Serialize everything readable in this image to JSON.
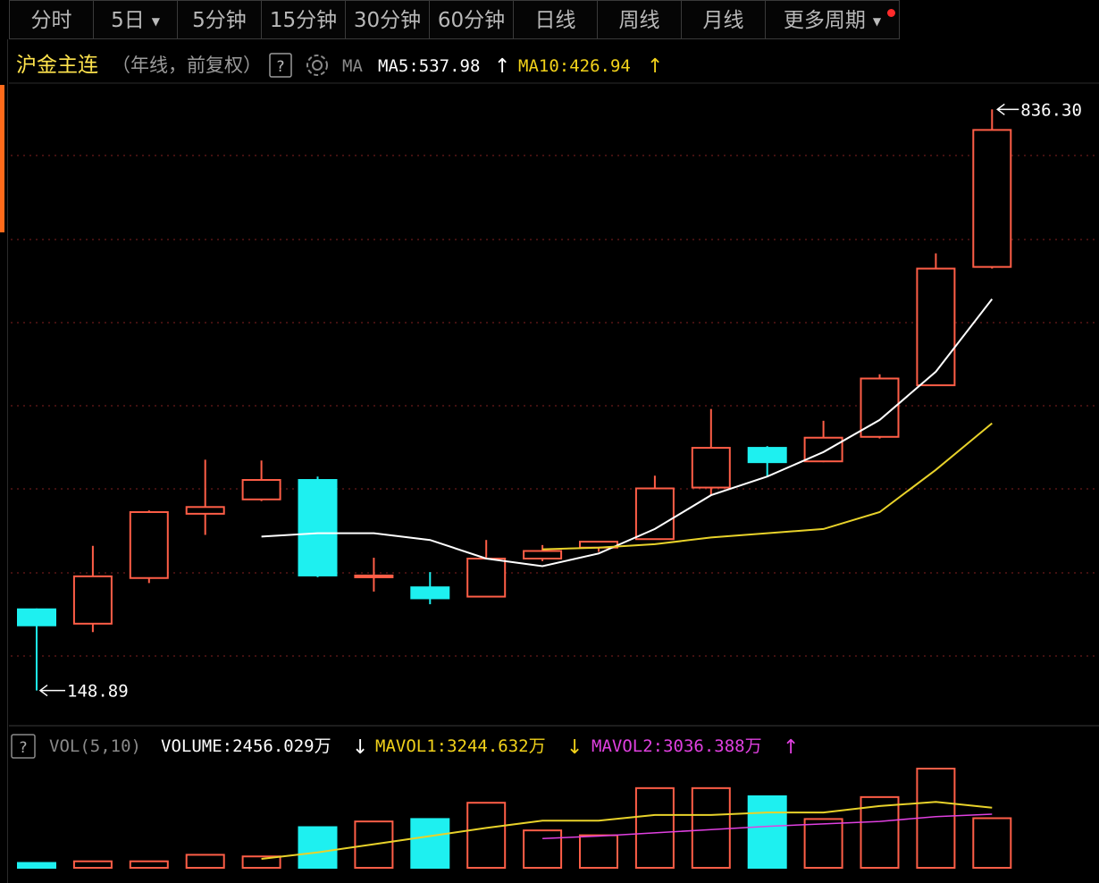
{
  "tabs": [
    {
      "label": "分时",
      "width": 95
    },
    {
      "label": "5日",
      "width": 94,
      "dropdown": true
    },
    {
      "label": "5分钟",
      "width": 94
    },
    {
      "label": "15分钟",
      "width": 94
    },
    {
      "label": "30分钟",
      "width": 94
    },
    {
      "label": "60分钟",
      "width": 94
    },
    {
      "label": "日线",
      "width": 94
    },
    {
      "label": "周线",
      "width": 94
    },
    {
      "label": "月线",
      "width": 94
    },
    {
      "label": "更多周期",
      "width": 150,
      "dropdown": true,
      "badge": true
    }
  ],
  "header": {
    "name": "沪金主连",
    "mode": "（年线，前复权）",
    "help": "?",
    "ma_label": "MA",
    "ma5_text": "MA5:537.98",
    "ma10_text": "MA10:426.94",
    "ma5_arrow": "↑",
    "ma10_arrow": "↑"
  },
  "vol_header": {
    "help": "?",
    "indicator": "VOL(5,10)",
    "volume_text": "VOLUME:2456.029万",
    "volume_arrow": "↓",
    "mavol1_text": "MAVOL1:3244.632万",
    "mavol1_arrow": "↓",
    "mavol2_text": "MAVOL2:3036.388万",
    "mavol2_arrow": "↑"
  },
  "colors": {
    "up": "#ff5e47",
    "down": "#1ef0f0",
    "ma5": "#ffffff",
    "ma10": "#e8d22a",
    "mavol2": "#e040e0",
    "grid": "#6a1a1a",
    "name": "#ffe44d"
  },
  "chart_data": {
    "type": "candlestick",
    "price_range": [
      120,
      860
    ],
    "high_label": "836.30",
    "low_label": "148.89",
    "candles": [
      {
        "open": 245,
        "close": 226,
        "high": 246,
        "low": 149
      },
      {
        "open": 228,
        "close": 284,
        "high": 320,
        "low": 218
      },
      {
        "open": 282,
        "close": 360,
        "high": 362,
        "low": 276
      },
      {
        "open": 358,
        "close": 366,
        "high": 422,
        "low": 333
      },
      {
        "open": 375,
        "close": 398,
        "high": 421,
        "low": 373
      },
      {
        "open": 398,
        "close": 285,
        "high": 402,
        "low": 283
      },
      {
        "open": 284,
        "close": 285,
        "high": 306,
        "low": 266
      },
      {
        "open": 271,
        "close": 258,
        "high": 289,
        "low": 251
      },
      {
        "open": 260,
        "close": 305,
        "high": 327,
        "low": 260
      },
      {
        "open": 305,
        "close": 314,
        "high": 321,
        "low": 302
      },
      {
        "open": 318,
        "close": 325,
        "high": 325,
        "low": 313
      },
      {
        "open": 328,
        "close": 388,
        "high": 403,
        "low": 328
      },
      {
        "open": 389,
        "close": 436,
        "high": 482,
        "low": 380
      },
      {
        "open": 436,
        "close": 419,
        "high": 438,
        "low": 402
      },
      {
        "open": 420,
        "close": 448,
        "high": 468,
        "low": 419
      },
      {
        "open": 449,
        "close": 518,
        "high": 523,
        "low": 447
      },
      {
        "open": 510,
        "close": 648,
        "high": 666,
        "low": 509
      },
      {
        "open": 650,
        "close": 812,
        "high": 836.3,
        "low": 648
      }
    ],
    "ma5": [
      null,
      null,
      null,
      null,
      331,
      335,
      335,
      327,
      305,
      296,
      311,
      340,
      380,
      402,
      431,
      469,
      526,
      612
    ],
    "ma10": [
      null,
      null,
      null,
      null,
      null,
      null,
      null,
      null,
      null,
      316,
      318,
      322,
      330,
      335,
      340,
      360,
      410,
      465
    ],
    "volume_range": [
      0,
      9000
    ],
    "volume": [
      600,
      800,
      800,
      1600,
      1400,
      5000,
      5700,
      6000,
      8000,
      4600,
      4000,
      9800,
      9800,
      8800,
      6000,
      8700,
      12200,
      6100
    ],
    "mavol1": [
      null,
      null,
      null,
      null,
      1100,
      1900,
      2900,
      3900,
      4900,
      5800,
      5800,
      6500,
      6500,
      6800,
      6800,
      7600,
      8100,
      7400
    ],
    "mavol2": [
      null,
      null,
      null,
      null,
      null,
      null,
      null,
      null,
      null,
      3600,
      3900,
      4300,
      4700,
      5100,
      5400,
      5700,
      6300,
      6600
    ]
  }
}
